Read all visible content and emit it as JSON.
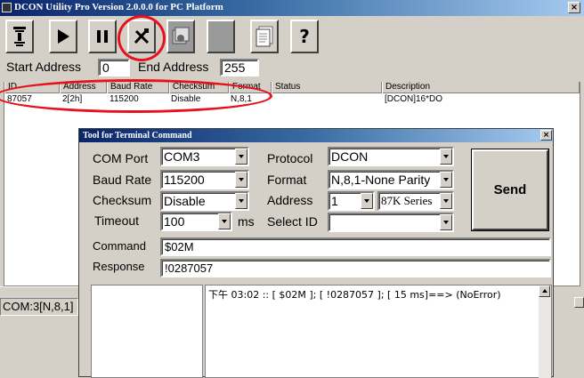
{
  "window": {
    "title": "DCON Utility Pro Version 2.0.0.0 for PC Platform",
    "close": "×"
  },
  "toolbar": [
    {
      "icon": "search-device-icon"
    },
    {
      "icon": "play-icon"
    },
    {
      "icon": "pause-icon"
    },
    {
      "icon": "tools-icon"
    },
    {
      "icon": "module-icon"
    },
    {
      "icon": "blank-icon"
    },
    {
      "icon": "document-icon"
    },
    {
      "icon": "help-icon",
      "label": "?"
    }
  ],
  "address": {
    "start_label": "Start Address",
    "start_value": "0",
    "end_label": "End Address",
    "end_value": "255"
  },
  "list": {
    "columns": [
      "ID",
      "Address",
      "Baud Rate",
      "Checksum",
      "Format",
      "Status",
      "Description"
    ],
    "rows": [
      {
        "id": "87057",
        "address": "2[2h]",
        "baud": "115200",
        "checksum": "Disable",
        "format": "N,8,1",
        "status": "",
        "description": "[DCON]16*DO"
      }
    ]
  },
  "statusbar": {
    "com": "COM:3[N,8,1]"
  },
  "dialog": {
    "title": "Tool for Terminal Command",
    "com_port_label": "COM Port",
    "com_port": "COM3",
    "baud_label": "Baud Rate",
    "baud": "115200",
    "checksum_label": "Checksum",
    "checksum": "Disable",
    "timeout_label": "Timeout",
    "timeout": "100",
    "timeout_unit": "ms",
    "protocol_label": "Protocol",
    "protocol": "DCON",
    "format_label": "Format",
    "format": "N,8,1-None Parity",
    "address_label": "Address",
    "address": "1",
    "series": "87K Series",
    "select_id_label": "Select ID",
    "select_id": "",
    "send_label": "Send",
    "command_label": "Command",
    "command": "$02M",
    "response_label": "Response",
    "response": "!0287057",
    "log": "下午 03:02 :: [ $02M ]; [ !0287057 ]; [ 15 ms]==> (NoError)"
  },
  "colors": {
    "annotation": "#e8101a",
    "title_start": "#0a246a"
  }
}
